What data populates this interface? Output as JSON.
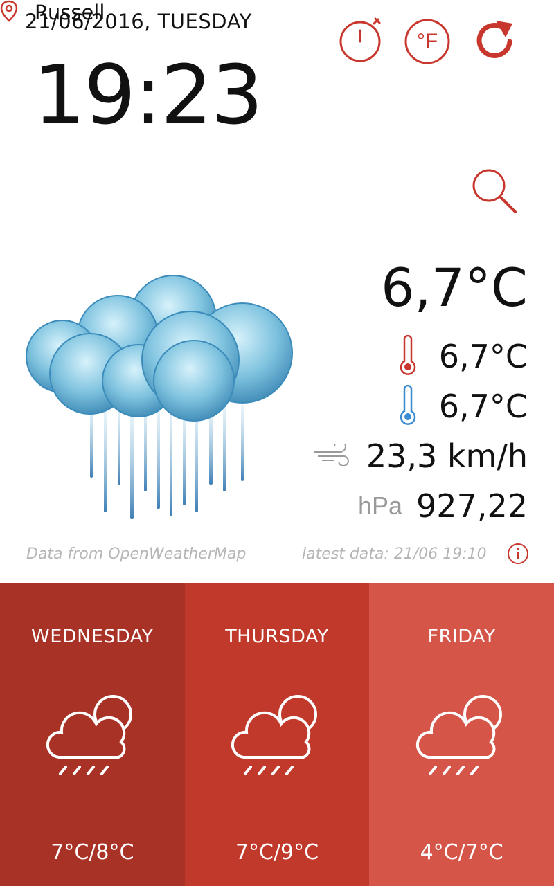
{
  "header": {
    "date": "21/06/2016, TUESDAY",
    "time": "19:23",
    "location": "Russell"
  },
  "toolbar": {
    "timer_icon": "stopwatch-icon",
    "unit_label": "°F",
    "refresh_icon": "refresh-icon",
    "search_icon": "search-icon"
  },
  "current": {
    "condition_icon": "rain-cloud-icon",
    "temperature": "6,7°C",
    "max_temperature": "6,7°C",
    "min_temperature": "6,7°C",
    "wind": "23,3 km/h",
    "pressure_unit": "hPa",
    "pressure": "927,22"
  },
  "footer": {
    "source": "Data from OpenWeatherMap",
    "latest": "latest data: 21/06 19:10"
  },
  "forecast": [
    {
      "day": "WEDNESDAY",
      "temps": "7°C/8°C",
      "icon": "cloud-sun-rain-icon"
    },
    {
      "day": "THURSDAY",
      "temps": "7°C/9°C",
      "icon": "cloud-sun-rain-icon"
    },
    {
      "day": "FRIDAY",
      "temps": "4°C/7°C",
      "icon": "cloud-sun-rain-icon"
    }
  ],
  "colors": {
    "accent": "#c8372d",
    "day1": "#a93226",
    "day2": "#c0392b",
    "day3": "#d55549"
  }
}
